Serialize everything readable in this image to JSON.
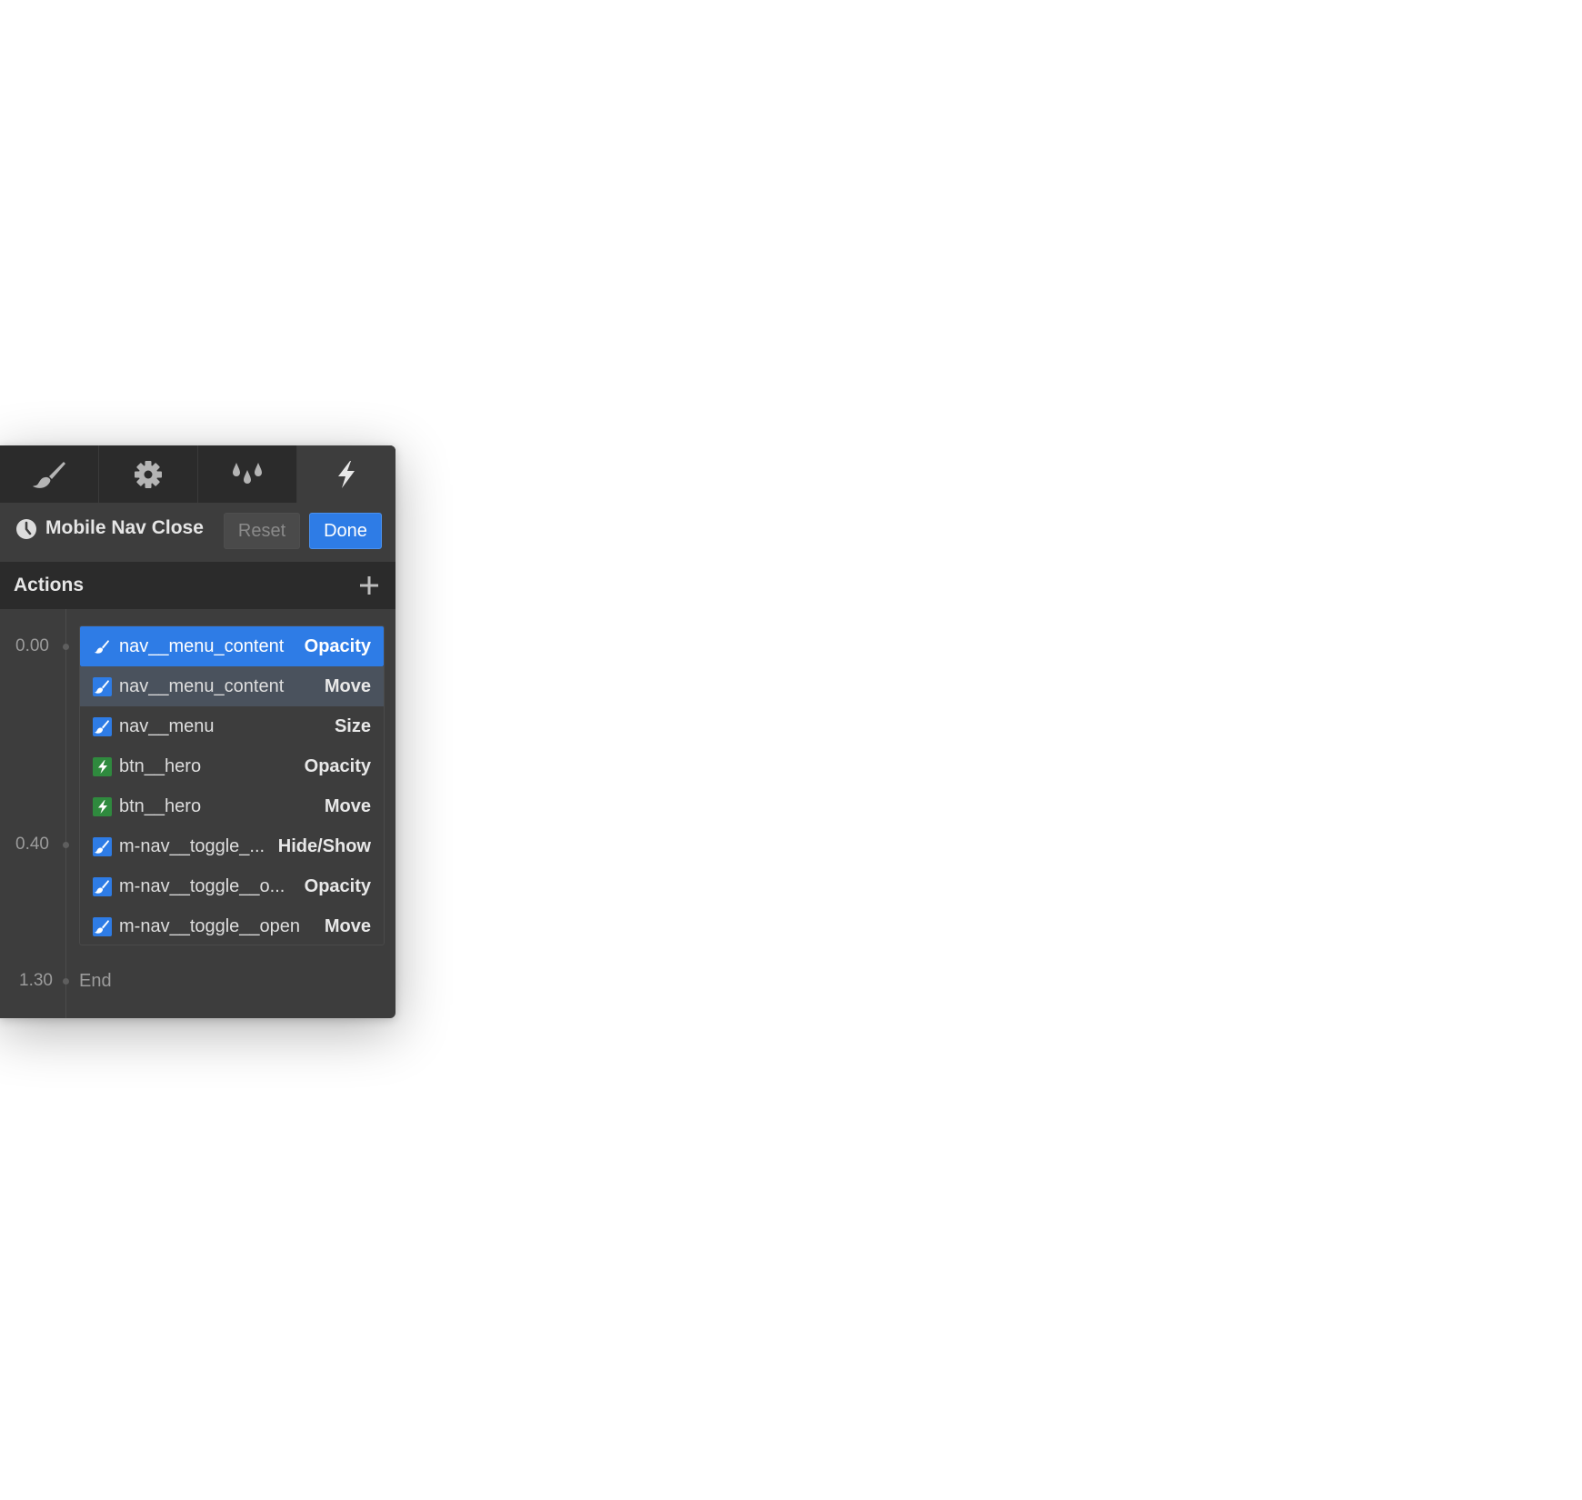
{
  "tabs": [
    {
      "name": "style",
      "icon": "paintbrush-icon",
      "active": false
    },
    {
      "name": "settings",
      "icon": "gear-icon",
      "active": false
    },
    {
      "name": "style-manager",
      "icon": "drops-icon",
      "active": false
    },
    {
      "name": "interactions",
      "icon": "lightning-icon",
      "active": true
    }
  ],
  "interaction": {
    "icon": "clock-icon",
    "title": "Mobile Nav Close",
    "reset_label": "Reset",
    "done_label": "Done"
  },
  "actions_panel": {
    "title": "Actions",
    "add_icon": "plus-icon"
  },
  "timeline": {
    "markers": [
      "0.00",
      "0.40",
      "1.30"
    ],
    "end_label": "End"
  },
  "actions": [
    {
      "element": "nav__menu_content",
      "action": "Opacity",
      "icon": "paintbrush-icon",
      "state": "selected"
    },
    {
      "element": "nav__menu_content",
      "action": "Move",
      "icon": "paintbrush-icon",
      "state": "highlighted"
    },
    {
      "element": "nav__menu",
      "action": "Size",
      "icon": "paintbrush-icon",
      "state": "normal"
    },
    {
      "element": "btn__hero",
      "action": "Opacity",
      "icon": "lightning-icon",
      "state": "normal"
    },
    {
      "element": "btn__hero",
      "action": "Move",
      "icon": "lightning-icon",
      "state": "normal"
    },
    {
      "element": "m-nav__toggle_...",
      "action": "Hide/Show",
      "icon": "paintbrush-icon",
      "state": "normal"
    },
    {
      "element": "m-nav__toggle__o...",
      "action": "Opacity",
      "icon": "paintbrush-icon",
      "state": "normal"
    },
    {
      "element": "m-nav__toggle__open",
      "action": "Move",
      "icon": "paintbrush-icon",
      "state": "normal"
    }
  ],
  "colors": {
    "panel_bg": "#3d3d3d",
    "header_bg": "#2b2b2b",
    "accent_blue": "#2e7ce6",
    "bolt_green": "#2f8a3e"
  }
}
